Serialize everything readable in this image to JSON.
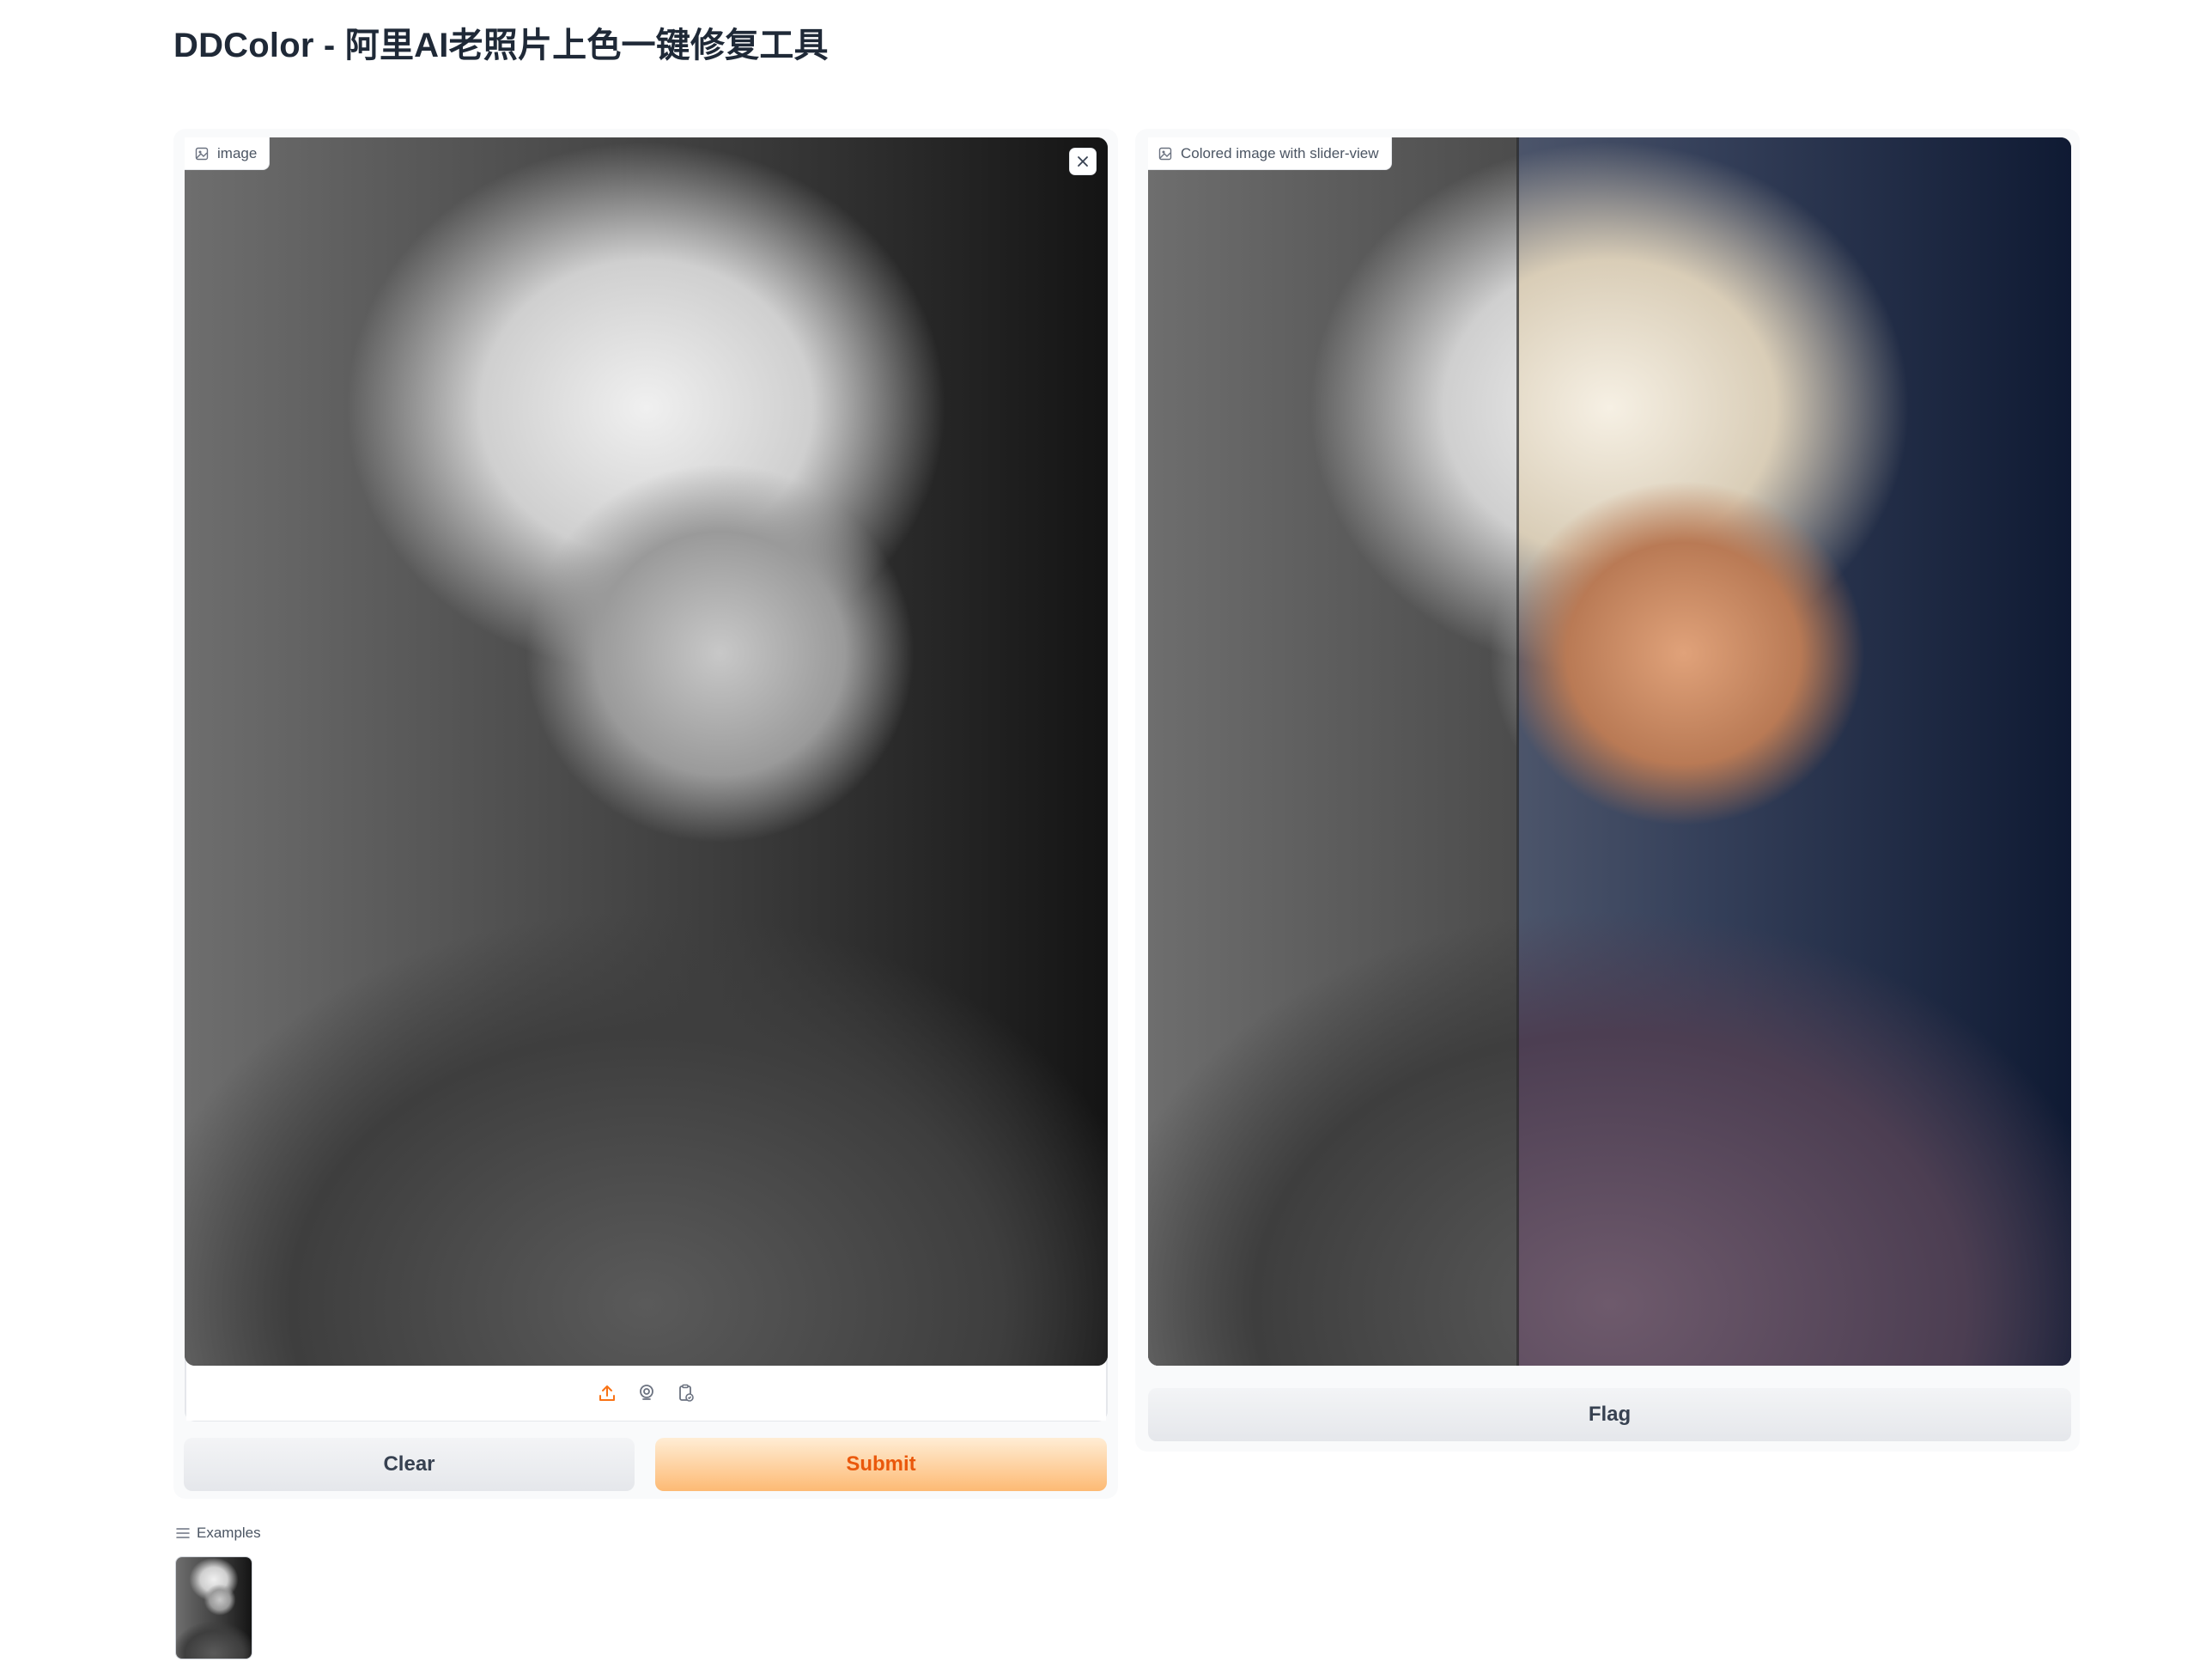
{
  "page": {
    "title": "DDColor - 阿里AI老照片上色一键修复工具"
  },
  "input_panel": {
    "label": "image",
    "close_icon": "close-icon",
    "toolbar_icons": [
      "upload-icon",
      "webcam-icon",
      "clipboard-icon"
    ]
  },
  "output_panel": {
    "label": "Colored image with slider-view",
    "slider_position": 0.4
  },
  "buttons": {
    "clear": "Clear",
    "submit": "Submit",
    "flag": "Flag"
  },
  "examples": {
    "label": "Examples",
    "items": [
      "einstein-thumbnail"
    ]
  },
  "colors": {
    "accent": "#ea580c",
    "submit_gradient_start": "#ffedd5",
    "submit_gradient_end": "#fdba74"
  }
}
